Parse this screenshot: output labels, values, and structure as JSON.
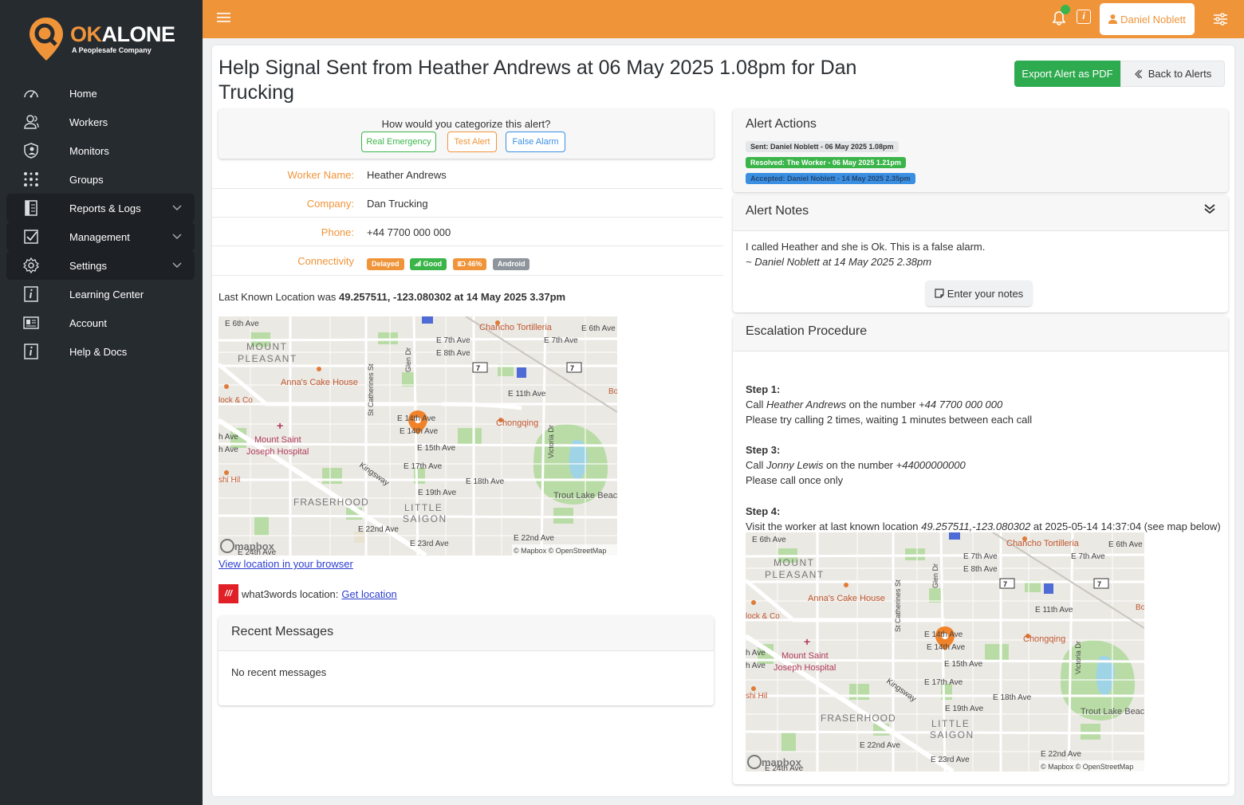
{
  "brand": {
    "name_ok": "OK",
    "name_rest": "ALONE",
    "tagline": "A Peoplesafe Company",
    "accent": "#f0943a"
  },
  "sidebar": {
    "items": [
      {
        "label": "Home",
        "icon": "speedometer-icon"
      },
      {
        "label": "Workers",
        "icon": "users-icon"
      },
      {
        "label": "Monitors",
        "icon": "shield-user-icon"
      },
      {
        "label": "Groups",
        "icon": "network-icon"
      },
      {
        "label": "Reports & Logs",
        "icon": "report-icon"
      },
      {
        "label": "Management",
        "icon": "checklist-icon"
      },
      {
        "label": "Settings",
        "icon": "gear-icon"
      },
      {
        "label": "Learning Center",
        "icon": "info-icon"
      },
      {
        "label": "Account",
        "icon": "id-card-icon"
      },
      {
        "label": "Help & Docs",
        "icon": "info-icon"
      }
    ]
  },
  "topbar": {
    "user_name": "Daniel Noblett",
    "info_glyph": "i"
  },
  "page": {
    "title": "Help Signal Sent from Heather Andrews at 06 May 2025 1.08pm for Dan Trucking",
    "export_label": "Export Alert as PDF",
    "back_label": "Back to Alerts"
  },
  "categorize": {
    "question": "How would you categorize this alert?",
    "real": "Real Emergency",
    "test": "Test Alert",
    "false": "False Alarm"
  },
  "worker": {
    "name_label": "Worker Name:",
    "name": "Heather Andrews",
    "company_label": "Company:",
    "company": "Dan Trucking",
    "phone_label": "Phone:",
    "phone": "+44 7700 000 000",
    "connectivity_label": "Connectivity",
    "badges": {
      "delayed": "Delayed",
      "good": "Good",
      "battery": "46%",
      "os": "Android"
    }
  },
  "location": {
    "prefix": "Last Known Location was ",
    "value": "49.257511, -123.080302 at 14 May 2025 3.37pm",
    "view_link": "View location in your browser",
    "w3w_logo": "///",
    "w3w_label": "what3words location:",
    "w3w_link": "Get location"
  },
  "map": {
    "labels": {
      "e6th": "E 6th Ave",
      "e7th": "E 7th Ave",
      "e8th": "E 8th Ave",
      "e11th": "E 11th Ave",
      "e15th": "E 15th Ave",
      "e17th": "E 17th Ave",
      "e18th": "E 18th Ave",
      "e19th": "E 19th Ave",
      "e22nd": "E 22nd Ave",
      "e23rd": "E 23rd Ave",
      "e24th": "E 24th Ave",
      "e14th": "E 14th Ave",
      "mount1": "MOUNT",
      "mount2": "PLEASANT",
      "anna": "Anna's Cake House",
      "chancho": "Chancho Tortilleria",
      "chongqing": "Chongqing",
      "hospital1": "Mount Saint",
      "hospital2": "Joseph Hospital",
      "fraser": "FRASERHOOD",
      "little1": "LITTLE",
      "little2": "SAIGON",
      "trout": "Trout Lake Beach",
      "kingsway": "Kingsway",
      "stcath": "St Catherines St",
      "glen": "Glen Dr",
      "victoria": "Victoria Dr",
      "lock": "lock & Co",
      "shihil": "shi Hil",
      "route": "7",
      "mapbox": "mapbox",
      "attrib": "© Mapbox © OpenStreetMap",
      "bo": "Bo",
      "have": "h Ave",
      "h2ave": "h Ave"
    }
  },
  "messages": {
    "title": "Recent Messages",
    "empty": "No recent messages"
  },
  "actions": {
    "title": "Alert Actions",
    "sent": "Sent: Daniel Noblett - 06 May 2025 1.08pm",
    "resolved": "Resolved: The Worker - 06 May 2025 1.21pm",
    "accepted": "Accepted: Daniel Noblett - 14 May 2025 2.35pm"
  },
  "notes": {
    "title": "Alert Notes",
    "text": "I called Heather and she is Ok. This is a false alarm.",
    "author": "~ Daniel Noblett at 14 May 2025 2.38pm",
    "button": "Enter your notes"
  },
  "escalation": {
    "title": "Escalation Procedure",
    "step1": {
      "heading": "Step 1:",
      "call": "Call ",
      "who": "Heather Andrews",
      "mid": " on the number ",
      "number": "+44 7700 000 000",
      "instr": "Please try calling 2 times, waiting 1 minutes between each call"
    },
    "step3": {
      "heading": "Step 3:",
      "call": "Call ",
      "who": "Jonny Lewis",
      "mid": " on the number ",
      "number": "+44000000000",
      "instr": "Please call once only"
    },
    "step4": {
      "heading": "Step 4:",
      "pre": "Visit the worker at last known location ",
      "coords": "49.257511,-123.080302",
      "post": " at 2025-05-14 14:37:04 (see map below)"
    }
  }
}
